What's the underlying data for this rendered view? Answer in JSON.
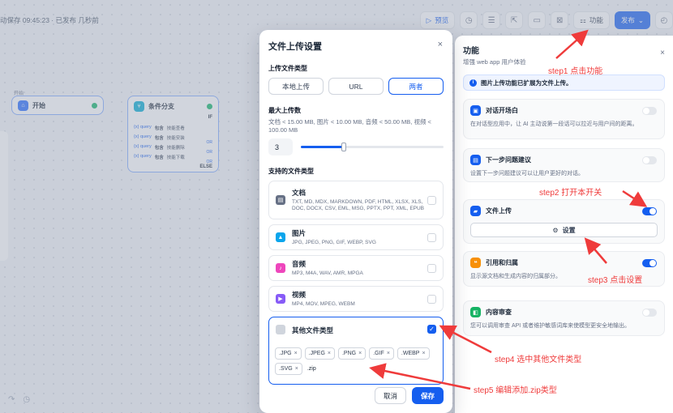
{
  "topbar": {
    "autosave": "动保存 09:45:23 · 已发布 几秒前",
    "preview": "预览",
    "features": "功能",
    "publish": "发布"
  },
  "workflow": {
    "start_caption": "开始",
    "start_label": "开始",
    "branch_label": "条件分支",
    "if_label": "IF",
    "else_label": "ELSE",
    "conditions": [
      {
        "var": "{x} query",
        "op": "包含",
        "val": "技能查看"
      },
      {
        "var": "{x} query",
        "op": "包含",
        "val": "技能安装"
      },
      {
        "var": "{x} query",
        "op": "包含",
        "val": "技能删除"
      },
      {
        "var": "{x} query",
        "op": "包含",
        "val": "技能下载"
      }
    ],
    "or_label": "OR"
  },
  "modal": {
    "title": "文件上传设置",
    "upload_type_label": "上传文件类型",
    "upload_options": [
      "本地上传",
      "URL",
      "两者"
    ],
    "selected_option": "两者",
    "max_label": "最大上传数",
    "max_hint": "文档 < 15.00 MB, 图片 < 10.00 MB, 音频 < 50.00 MB, 视频 < 100.00 MB",
    "max_value": "3",
    "max_fraction": 0.3,
    "supported_label": "支持的文件类型",
    "types": [
      {
        "title": "文档",
        "desc": "TXT, MD, MDX, MARKDOWN, PDF, HTML, XLSX, XLS, DOC, DOCX, CSV, EML, MSG, PPTX, PPT, XML, EPUB",
        "color": "#667085",
        "checked": false
      },
      {
        "title": "图片",
        "desc": "JPG, JPEG, PNG, GIF, WEBP, SVG",
        "color": "#0ba5ec",
        "checked": false
      },
      {
        "title": "音频",
        "desc": "MP3, M4A, WAV, AMR, MPGA",
        "color": "#ee46bc",
        "checked": false
      },
      {
        "title": "视频",
        "desc": "MP4, MOV, MPEG, WEBM",
        "color": "#875bf7",
        "checked": false
      }
    ],
    "other_title": "其他文件类型",
    "other_checked": true,
    "extensions": [
      ".JPG",
      ".JPEG",
      ".PNG",
      ".GIF",
      ".WEBP",
      ".SVG"
    ],
    "new_extension": ".zip",
    "cancel": "取消",
    "save": "保存"
  },
  "panel": {
    "title": "功能",
    "subtitle": "增强 web app 用户体验",
    "info": "图片上传功能已扩展为文件上传。",
    "features": [
      {
        "key": "opening",
        "title": "对话开场白",
        "desc": "在对话型应用中，让 AI 主动说第一段话可以拉近与用户间的距离。",
        "on": false,
        "color": "#155eef"
      },
      {
        "key": "suggest",
        "title": "下一步问题建议",
        "desc": "设置下一步问题建议可以让用户更好的对话。",
        "on": false,
        "color": "#155eef"
      },
      {
        "key": "upload",
        "title": "文件上传",
        "desc": "",
        "on": true,
        "color": "#155eef"
      },
      {
        "key": "citation",
        "title": "引用和归属",
        "desc": "显示源文档和生成内容的归属部分。",
        "on": true,
        "color": "#f79009"
      },
      {
        "key": "moderation",
        "title": "内容审查",
        "desc": "您可以调用审查 API 或者维护敏感词库来使模型更安全地输出。",
        "on": false,
        "color": "#16b364"
      }
    ],
    "settings_button": "设置"
  },
  "annotations": {
    "step1": "step1 点击功能",
    "step2": "step2 打开本开关",
    "step3": "step3 点击设置",
    "step4": "step4 选中其他文件类型",
    "step5": "step5 编辑添加.zip类型"
  },
  "colors": {
    "accent": "#155eef",
    "annotation": "#ef3b3b"
  }
}
